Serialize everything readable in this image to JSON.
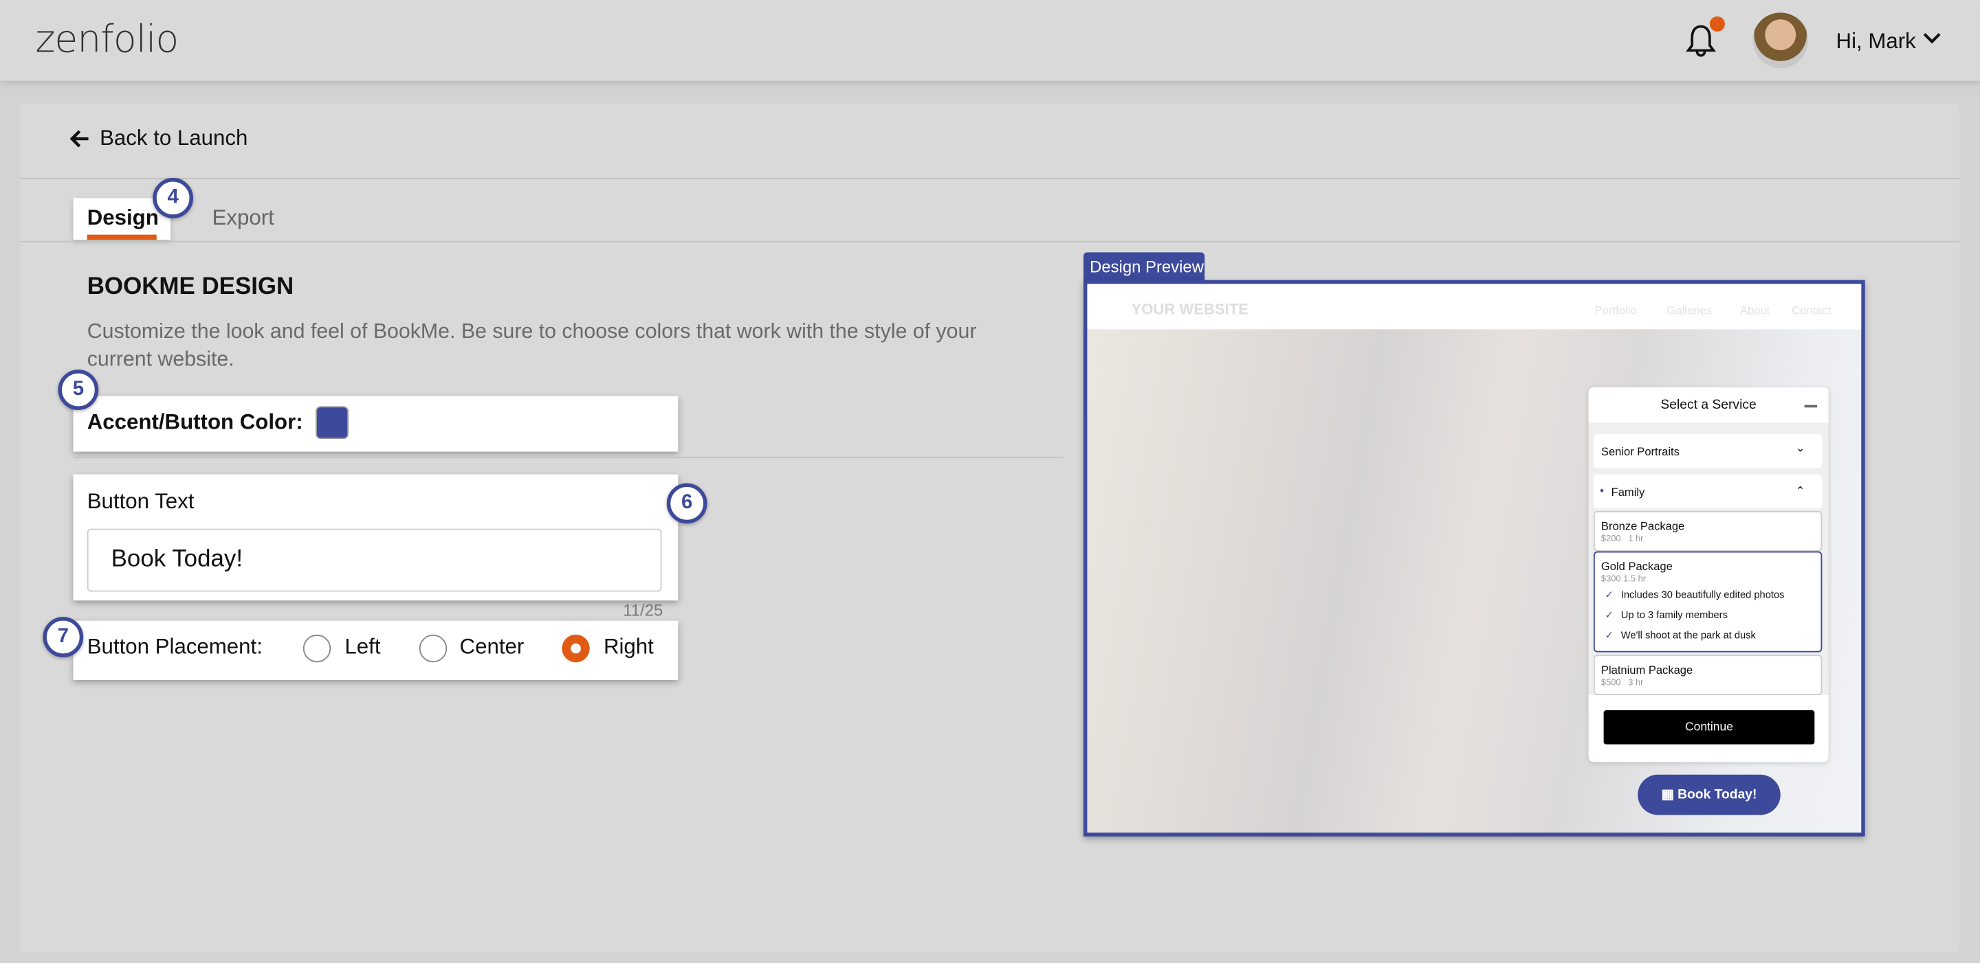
{
  "header": {
    "logo": "zenfolio",
    "greeting": "Hi, Mark",
    "notification_dot_color": "#e05a14"
  },
  "nav": {
    "back_label": "Back to Launch"
  },
  "tabs": [
    {
      "label": "Design",
      "active": true
    },
    {
      "label": "Export",
      "active": false
    }
  ],
  "badges": [
    "4",
    "5",
    "6",
    "7"
  ],
  "design": {
    "title": "BOOKME DESIGN",
    "description": "Customize the look and feel of BookMe. Be sure to choose colors that work with the style of your current website.",
    "accent_label": "Accent/Button Color:",
    "accent_color": "#3d4a9b",
    "button_text_label": "Button Text",
    "button_text_value": "Book Today!",
    "button_text_counter": "11/25",
    "placement_label": "Button Placement:",
    "placement_options": [
      {
        "label": "Left",
        "selected": false
      },
      {
        "label": "Center",
        "selected": false
      },
      {
        "label": "Right",
        "selected": true
      }
    ]
  },
  "preview": {
    "tab_label": "Design Preview",
    "site_name": "YOUR WEBSITE",
    "site_nav": [
      "Portfolio",
      "Galleries",
      "About",
      "Contact"
    ],
    "widget": {
      "title": "Select a Service",
      "categories": [
        {
          "label": "Senior Portraits",
          "expanded": false
        },
        {
          "label": "Family",
          "expanded": true
        }
      ],
      "packages": [
        {
          "name": "Bronze Package",
          "price": "$200",
          "duration": "1 hr"
        },
        {
          "name": "Gold Package",
          "price": "$300",
          "duration": "1.5 hr",
          "features": [
            "Includes 30 beautifully edited photos",
            "Up to 3 family members",
            "We'll shoot at the park at dusk"
          ]
        },
        {
          "name": "Platnium Package",
          "price": "$500",
          "duration": "3 hr"
        }
      ],
      "continue_label": "Continue"
    },
    "book_button_label": "Book Today!"
  }
}
